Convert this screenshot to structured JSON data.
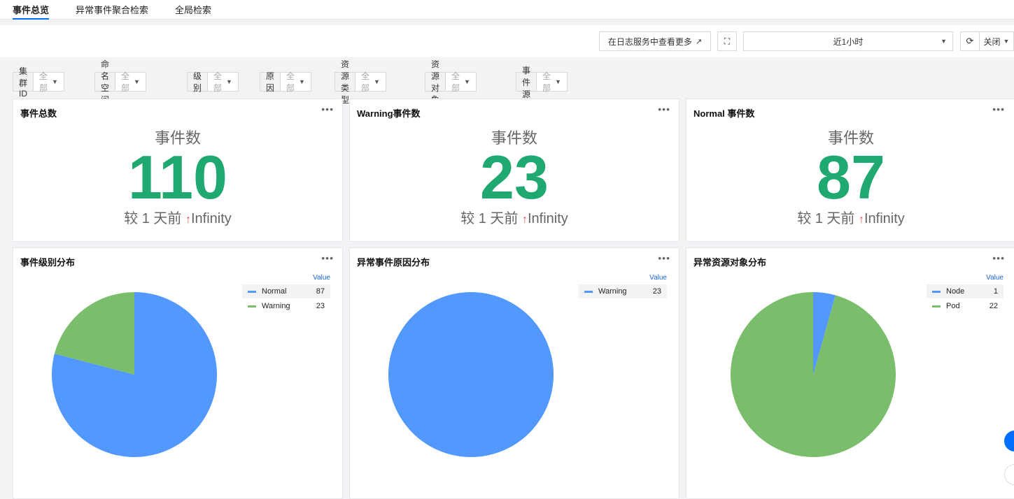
{
  "nav": {
    "tabs": [
      "事件总览",
      "异常事件聚合检索",
      "全局检索"
    ]
  },
  "toolbar": {
    "view_more_label": "在日志服务中查看更多",
    "time_range": "近1小时",
    "refresh_label": "关闭"
  },
  "filters": [
    {
      "label": "集群ID",
      "value": "全部"
    },
    {
      "label": "命名空间",
      "value": "全部"
    },
    {
      "label": "级别",
      "value": "全部"
    },
    {
      "label": "原因",
      "value": "全部"
    },
    {
      "label": "资源类型",
      "value": "全部"
    },
    {
      "label": "资源对象",
      "value": "全部"
    },
    {
      "label": "事件源",
      "value": "全部"
    }
  ],
  "stats": [
    {
      "title": "事件总数",
      "label": "事件数",
      "value": "110",
      "compare_prefix": "较 1 天前",
      "compare_value": "Infinity"
    },
    {
      "title": "Warning事件数",
      "label": "事件数",
      "value": "23",
      "compare_prefix": "较 1 天前",
      "compare_value": "Infinity"
    },
    {
      "title": "Normal 事件数",
      "label": "事件数",
      "value": "87",
      "compare_prefix": "较 1 天前",
      "compare_value": "Infinity"
    }
  ],
  "colors": {
    "blue": "#5298ff",
    "green": "#7abd6b",
    "accent": "#006eff",
    "stat_green": "#1fa870",
    "arrow_red": "#e34d59"
  },
  "pies": [
    {
      "title": "事件级别分布",
      "legend_header": "Value"
    },
    {
      "title": "异常事件原因分布",
      "legend_header": "Value"
    },
    {
      "title": "异常资源对象分布",
      "legend_header": "Value"
    }
  ],
  "chart_data": [
    {
      "type": "pie",
      "title": "事件级别分布",
      "categories": [
        "Normal",
        "Warning"
      ],
      "values": [
        87,
        23
      ],
      "colors": [
        "#5298ff",
        "#7abd6b"
      ],
      "legend_placement": "top-right"
    },
    {
      "type": "pie",
      "title": "异常事件原因分布",
      "categories": [
        "Warning"
      ],
      "values": [
        23
      ],
      "colors": [
        "#5298ff"
      ],
      "legend_placement": "top-right"
    },
    {
      "type": "pie",
      "title": "异常资源对象分布",
      "categories": [
        "Node",
        "Pod"
      ],
      "values": [
        1,
        22
      ],
      "colors": [
        "#5298ff",
        "#7abd6b"
      ],
      "legend_placement": "top-right"
    }
  ]
}
